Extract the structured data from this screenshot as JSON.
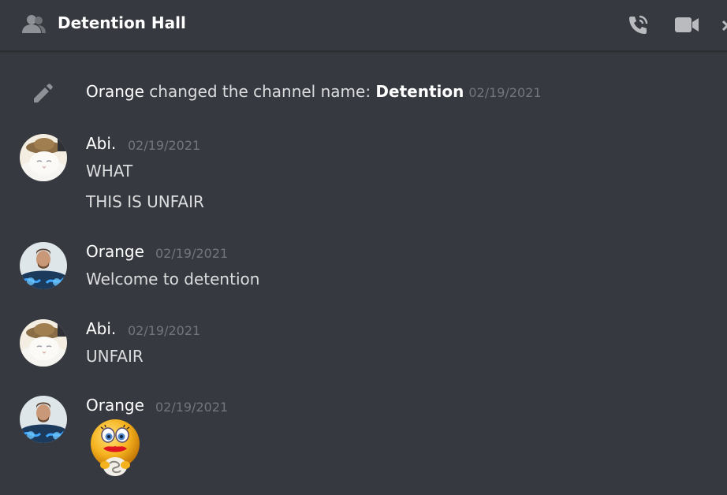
{
  "header": {
    "channel_name": "Detention Hall",
    "icons": [
      "group-icon",
      "call-icon",
      "video-icon",
      "more-icon"
    ]
  },
  "system_message": {
    "icon": "pencil-icon",
    "actor": "Orange",
    "action": "changed the channel name:",
    "new_name": "Detention",
    "timestamp": "02/19/2021"
  },
  "messages": [
    {
      "author": "Abi.",
      "timestamp": "02/19/2021",
      "avatar": "cat-avatar",
      "lines": [
        "WHAT",
        "THIS IS UNFAIR"
      ]
    },
    {
      "author": "Orange",
      "timestamp": "02/19/2021",
      "avatar": "hero-avatar",
      "lines": [
        "Welcome to detention"
      ]
    },
    {
      "author": "Abi.",
      "timestamp": "02/19/2021",
      "avatar": "cat-avatar",
      "lines": [
        "UNFAIR"
      ]
    },
    {
      "author": "Orange",
      "timestamp": "02/19/2021",
      "avatar": "hero-avatar",
      "lines": [],
      "sticker": "smiley-emoji-sticker"
    }
  ],
  "colors": {
    "background": "#36393f",
    "text": "#dcddde",
    "username": "#ffffff",
    "timestamp": "#72767d",
    "icon": "#b9bbbe"
  }
}
